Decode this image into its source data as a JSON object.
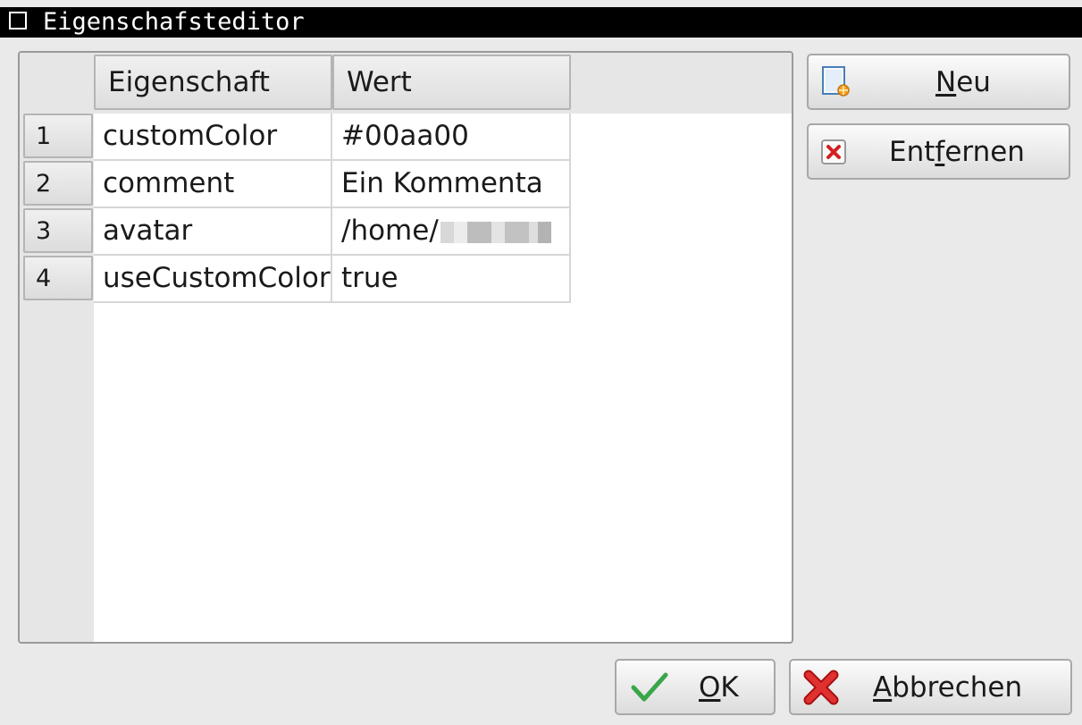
{
  "window": {
    "title": "Eigenschafsteditor"
  },
  "table": {
    "columns": [
      "Eigenschaft",
      "Wert"
    ],
    "rows": [
      {
        "num": "1",
        "property": "customColor",
        "value": "#00aa00"
      },
      {
        "num": "2",
        "property": "comment",
        "value": "Ein Kommenta"
      },
      {
        "num": "3",
        "property": "avatar",
        "value": "/home/"
      },
      {
        "num": "4",
        "property": "useCustomColor",
        "value": "true"
      }
    ]
  },
  "side_buttons": {
    "new": {
      "pre": "",
      "mnemonic": "N",
      "post": "eu",
      "icon": "new-document-icon"
    },
    "remove": {
      "pre": "Ent",
      "mnemonic": "f",
      "post": "ernen",
      "icon": "remove-icon"
    }
  },
  "dialog_buttons": {
    "ok": {
      "pre": "",
      "mnemonic": "O",
      "post": "K",
      "icon": "checkmark-icon"
    },
    "cancel": {
      "pre": "",
      "mnemonic": "A",
      "post": "bbrechen",
      "icon": "red-x-icon"
    }
  },
  "colors": {
    "titlebar": "#000000",
    "check": "#3aa64a",
    "cancel_red": "#d42020"
  }
}
